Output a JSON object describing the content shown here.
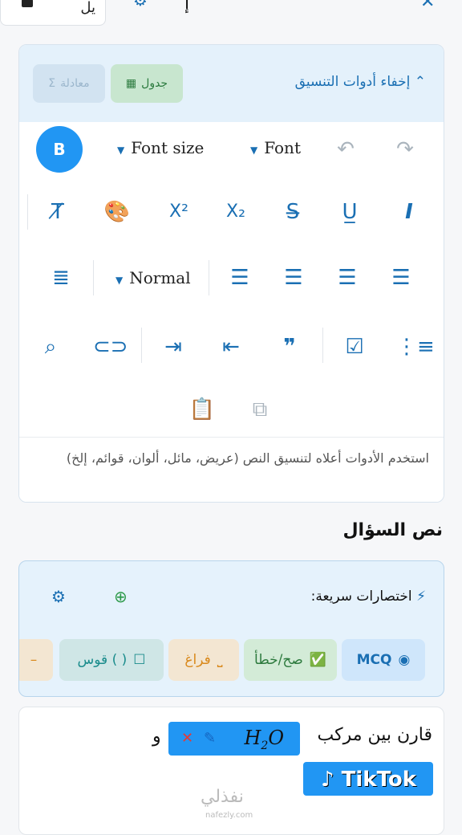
{
  "topbar": {
    "left_button_label": "يل",
    "title": "إ",
    "close_icon": "close-icon",
    "gear_icon": "gear-icon"
  },
  "toolbar_card": {
    "hide_tools_label": "إخفاء أدوات التنسيق",
    "table_chip_label": "جدول",
    "equation_chip_label": "معادلة",
    "font_size_label": "Font size",
    "font_label": "Font",
    "bold_label": "B",
    "paragraph_style_label": "Normal",
    "hint_text": "استخدم الأدوات أعلاه لتنسيق النص (عريض، مائل، ألوان، قوائم، إلخ)"
  },
  "question_title": "نص السؤال",
  "shortcuts": {
    "label": "اختصارات سريعة:",
    "pills": [
      {
        "label": "MCQ"
      },
      {
        "label": "صح/خطأ"
      },
      {
        "label": "فراغ"
      },
      {
        "label": "قوس ( )"
      }
    ]
  },
  "editor": {
    "text_start": "قارن بين مركب",
    "formula_main": "H",
    "formula_sub": "2",
    "formula_tail": "O",
    "conjunction": "و"
  },
  "colors": {
    "primary": "#2196f3",
    "accent_blue": "#1a6fb3",
    "header_bg": "#e4f1fb"
  }
}
